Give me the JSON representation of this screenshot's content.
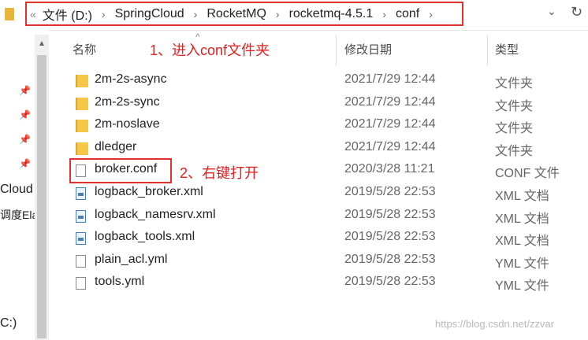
{
  "address_bar": {
    "back_glyph": "«",
    "segments": [
      "文件 (D:)",
      "SpringCloud",
      "RocketMQ",
      "rocketmq-4.5.1",
      "conf"
    ],
    "separator": "›",
    "dropdown_glyph": "⌄",
    "refresh_glyph": "↻"
  },
  "nav_pane": {
    "items": [
      "Cloud",
      "调度Ela",
      "C:)"
    ]
  },
  "columns": {
    "name": "名称",
    "modified": "修改日期",
    "type": "类型"
  },
  "annotations": {
    "step1": "1、进入conf文件夹",
    "step2": "2、右键打开"
  },
  "files": [
    {
      "name": "2m-2s-async",
      "date": "2021/7/29 12:44",
      "type": "文件夹",
      "icon": "folder-icon"
    },
    {
      "name": "2m-2s-sync",
      "date": "2021/7/29 12:44",
      "type": "文件夹",
      "icon": "folder-icon"
    },
    {
      "name": "2m-noslave",
      "date": "2021/7/29 12:44",
      "type": "文件夹",
      "icon": "folder-icon"
    },
    {
      "name": "dledger",
      "date": "2021/7/29 12:44",
      "type": "文件夹",
      "icon": "folder-icon"
    },
    {
      "name": "broker.conf",
      "date": "2020/3/28 11:21",
      "type": "CONF 文件",
      "icon": "file-icon"
    },
    {
      "name": "logback_broker.xml",
      "date": "2019/5/28 22:53",
      "type": "XML 文档",
      "icon": "xml-file-icon"
    },
    {
      "name": "logback_namesrv.xml",
      "date": "2019/5/28 22:53",
      "type": "XML 文档",
      "icon": "xml-file-icon"
    },
    {
      "name": "logback_tools.xml",
      "date": "2019/5/28 22:53",
      "type": "XML 文档",
      "icon": "xml-file-icon"
    },
    {
      "name": "plain_acl.yml",
      "date": "2019/5/28 22:53",
      "type": "YML 文件",
      "icon": "file-icon"
    },
    {
      "name": "tools.yml",
      "date": "2019/5/28 22:53",
      "type": "YML 文件",
      "icon": "file-icon"
    }
  ],
  "watermark": "https://blog.csdn.net/zzvar",
  "colors": {
    "annotation": "#e02020",
    "folder": "#f5c64a"
  }
}
